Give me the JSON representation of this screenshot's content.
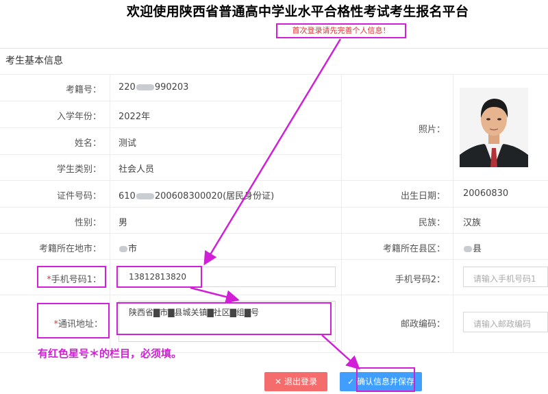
{
  "header": {
    "title": "欢迎使用陕西省普通高中学业水平合格性考试考生报名平台",
    "notice": "首次登录请先完善个人信息！"
  },
  "section": {
    "title": "考生基本信息"
  },
  "fields": {
    "exam_no": {
      "label": "考籍号：",
      "value_prefix": "220",
      "value_suffix": "990203"
    },
    "enroll_year": {
      "label": "入学年份：",
      "value": "2022年"
    },
    "name": {
      "label": "姓名：",
      "value": "测试"
    },
    "student_type": {
      "label": "学生类别：",
      "value": "社会人员"
    },
    "id_no": {
      "label": "证件号码：",
      "value_prefix": "610",
      "value_suffix": "200608300020(居民身份证)"
    },
    "photo": {
      "label": "照片："
    },
    "birth_date": {
      "label": "出生日期：",
      "value": "20060830"
    },
    "gender": {
      "label": "性别：",
      "value": "男"
    },
    "ethnicity": {
      "label": "民族：",
      "value": "汉族"
    },
    "city": {
      "label": "考籍所在地市：",
      "value_suffix": "市"
    },
    "county": {
      "label": "考籍所在县区：",
      "value_suffix": "县"
    },
    "phone1": {
      "required_mark": "*",
      "label": "手机号码1：",
      "value": "13812813820"
    },
    "phone2": {
      "label": "手机号码2：",
      "placeholder": "请输入手机号码1"
    },
    "address": {
      "required_mark": "*",
      "label": "通讯地址：",
      "value": "陕西省▇市▇县城关镇▇社区▇组▇号"
    },
    "postcode": {
      "label": "邮政编码：",
      "placeholder": "请输入邮政编码"
    }
  },
  "hint": "有红色星号＊的栏目，必须填。",
  "buttons": {
    "logout": {
      "icon": "✕",
      "label": "退出登录"
    },
    "save": {
      "icon": "✓",
      "label": "确认信息并保存"
    }
  },
  "colors": {
    "highlight": "#d01fd6",
    "danger": "#f56c6c",
    "primary": "#409eff",
    "required": "#e83434"
  }
}
